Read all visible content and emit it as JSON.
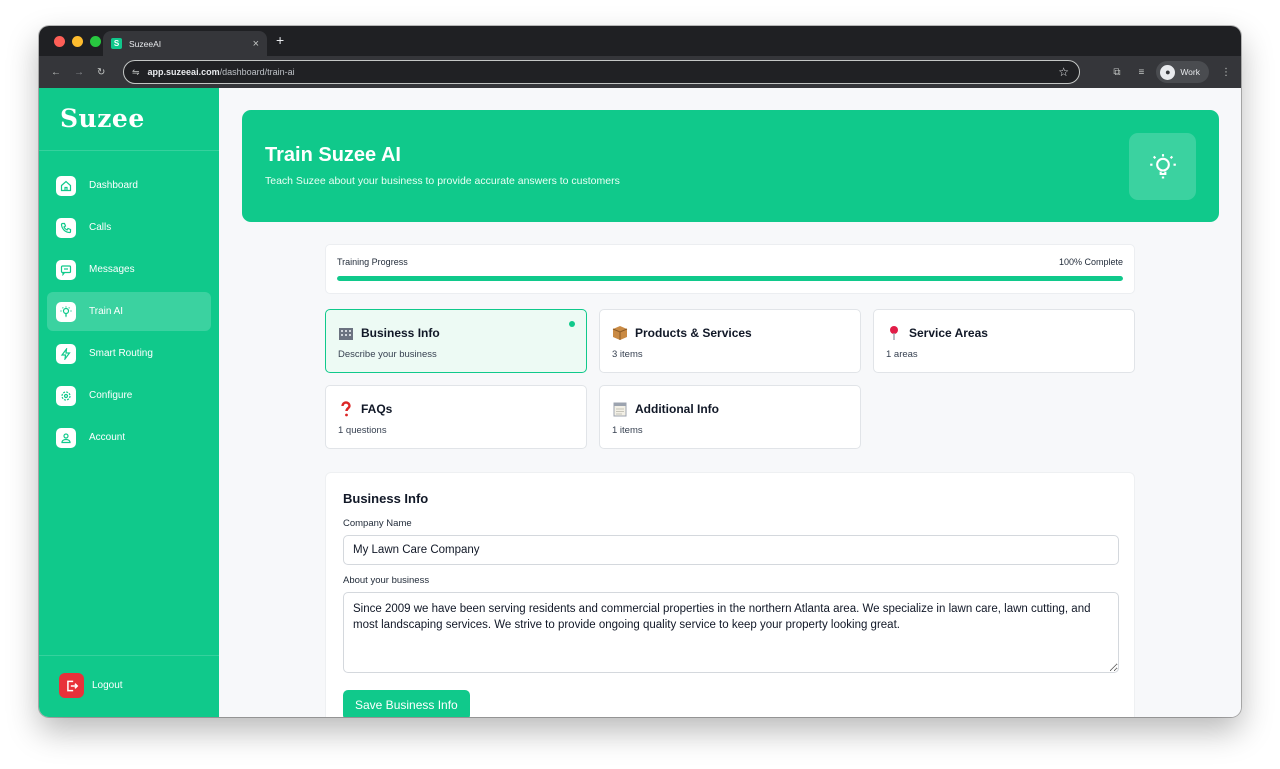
{
  "browser": {
    "tab_title": "SuzeeAI",
    "tab_favicon_letter": "S",
    "tab_close": "×",
    "new_tab": "+",
    "url_host": "app.suzeeai.com",
    "url_path": "/dashboard/train-ai",
    "profile_label": "Work"
  },
  "sidebar": {
    "logo": "Suzee",
    "items": [
      {
        "label": "Dashboard",
        "icon": "home-icon"
      },
      {
        "label": "Calls",
        "icon": "phone-icon"
      },
      {
        "label": "Messages",
        "icon": "message-icon"
      },
      {
        "label": "Train AI",
        "icon": "lightbulb-icon",
        "active": true
      },
      {
        "label": "Smart Routing",
        "icon": "lightning-icon"
      },
      {
        "label": "Configure",
        "icon": "gear-icon"
      },
      {
        "label": "Account",
        "icon": "user-icon"
      }
    ],
    "logout_label": "Logout"
  },
  "hero": {
    "title": "Train Suzee AI",
    "subtitle": "Teach Suzee about your business to provide accurate answers to customers"
  },
  "progress": {
    "label": "Training Progress",
    "status": "100% Complete",
    "value": 1.0
  },
  "sections": [
    {
      "icon": "building-icon",
      "title": "Business Info",
      "desc": "Describe your business",
      "active": true
    },
    {
      "icon": "package-icon",
      "title": "Products & Services",
      "desc": "3 items"
    },
    {
      "icon": "pin-icon",
      "title": "Service Areas",
      "desc": "1 areas"
    },
    {
      "icon": "question-icon",
      "title": "FAQs",
      "desc": "1 questions"
    },
    {
      "icon": "notepad-icon",
      "title": "Additional Info",
      "desc": "1 items"
    }
  ],
  "form": {
    "title": "Business Info",
    "company_label": "Company Name",
    "company_value": "My Lawn Care Company",
    "about_label": "About your business",
    "about_value": "Since 2009 we have been serving residents and commercial properties in the northern Atlanta area. We specialize in lawn care, lawn cutting, and most landscaping services. We strive to provide ongoing quality service to keep your property looking great.",
    "save_label": "Save Business Info"
  },
  "colors": {
    "brand": "#10c98b",
    "logout": "#e8313a"
  }
}
